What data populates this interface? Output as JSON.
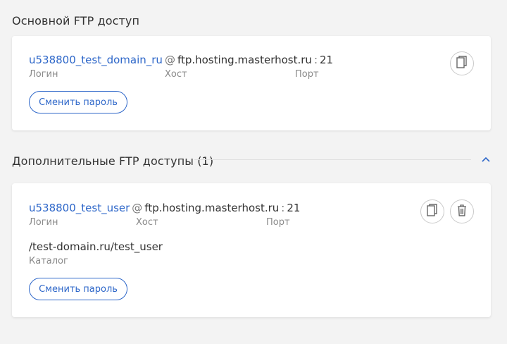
{
  "main_section": {
    "title": "Основной FTP доступ",
    "login": "u538800_test_domain_ru",
    "at": "@",
    "host": "ftp.hosting.masterhost.ru",
    "colon": ":",
    "port": "21",
    "login_label": "Логин",
    "host_label": "Хост",
    "port_label": "Порт",
    "change_password_label": "Сменить пароль",
    "copy_icon": "copy-icon"
  },
  "additional_section": {
    "title": "Дополнительные FTP доступы (1)",
    "expanded": true,
    "chevron_icon": "chevron-up-icon",
    "accounts": [
      {
        "login": "u538800_test_user",
        "at": "@",
        "host": "ftp.hosting.masterhost.ru",
        "colon": ":",
        "port": "21",
        "login_label": "Логин",
        "host_label": "Хост",
        "port_label": "Порт",
        "path": "/test-domain.ru/test_user",
        "path_label": "Каталог",
        "change_password_label": "Сменить пароль",
        "copy_icon": "copy-icon",
        "delete_icon": "trash-icon"
      }
    ]
  },
  "colors": {
    "accent": "#2e67c9",
    "background": "#f3f3f3",
    "card": "#ffffff",
    "muted_text": "#8a8a8a"
  }
}
